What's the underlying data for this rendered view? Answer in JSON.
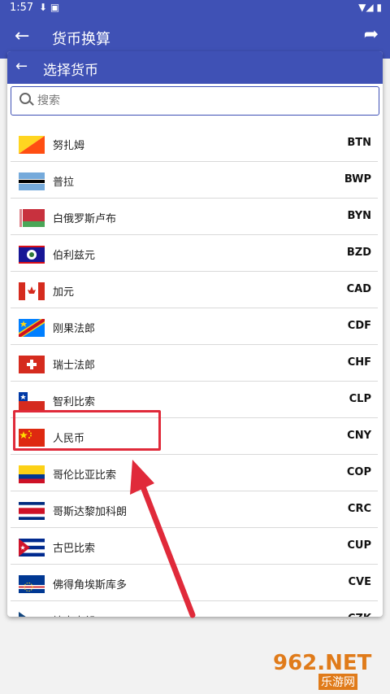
{
  "status_bar": {
    "time": "1:57"
  },
  "app_bar": {
    "title": "货币换算"
  },
  "dialog": {
    "title": "选择货币",
    "search": {
      "placeholder": "搜索",
      "value": ""
    }
  },
  "currencies": [
    {
      "name": "努扎姆",
      "code": "BTN"
    },
    {
      "name": "普拉",
      "code": "BWP"
    },
    {
      "name": "白俄罗斯卢布",
      "code": "BYN"
    },
    {
      "name": "伯利兹元",
      "code": "BZD"
    },
    {
      "name": "加元",
      "code": "CAD"
    },
    {
      "name": "刚果法郎",
      "code": "CDF"
    },
    {
      "name": "瑞士法郎",
      "code": "CHF"
    },
    {
      "name": "智利比索",
      "code": "CLP"
    },
    {
      "name": "人民币",
      "code": "CNY"
    },
    {
      "name": "哥伦比亚比索",
      "code": "COP"
    },
    {
      "name": "哥斯达黎加科朗",
      "code": "CRC"
    },
    {
      "name": "古巴比索",
      "code": "CUP"
    },
    {
      "name": "佛得角埃斯库多",
      "code": "CVE"
    },
    {
      "name": "捷克克朗",
      "code": "CZK"
    }
  ],
  "colors": {
    "primary": "#3f51b5",
    "highlight": "#e02a3a"
  },
  "watermark": {
    "main": "962.NET",
    "sub": "乐游网"
  }
}
